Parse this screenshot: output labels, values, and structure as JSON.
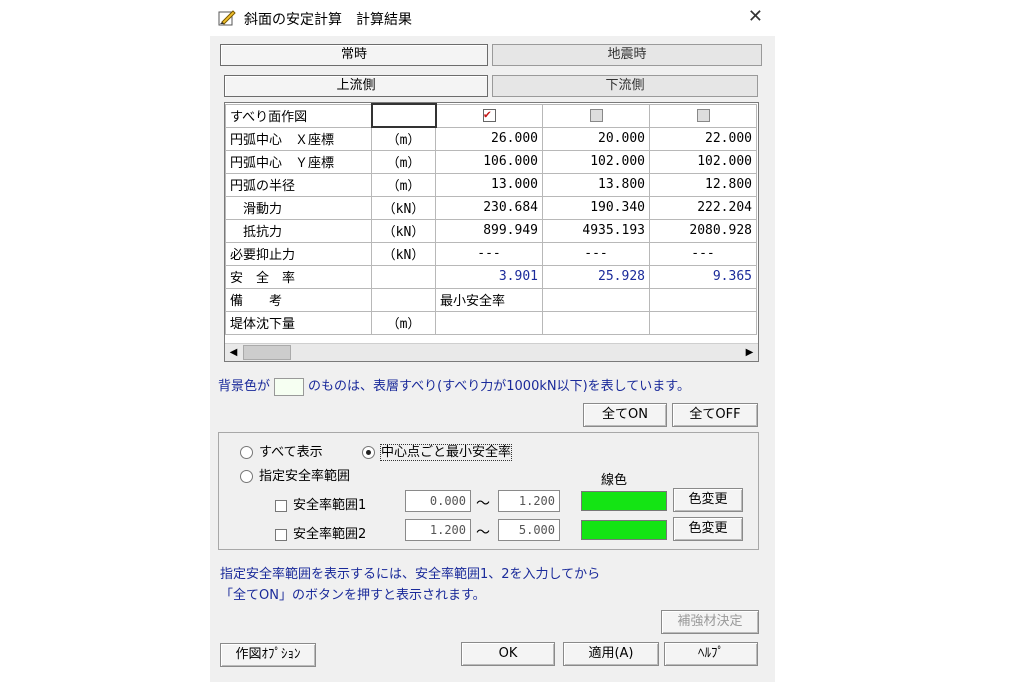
{
  "window": {
    "title": "斜面の安定計算　計算結果",
    "close_glyph": "✕"
  },
  "tabs_top": [
    {
      "label": "常時",
      "selected": true
    },
    {
      "label": "地震時",
      "selected": false
    }
  ],
  "tabs_side": [
    {
      "label": "上流側",
      "selected": true
    },
    {
      "label": "下流側",
      "selected": false
    }
  ],
  "grid": {
    "rows": [
      {
        "label": "すべり面作図",
        "unit": "",
        "type": "check",
        "values": [
          true,
          false,
          false
        ]
      },
      {
        "label": "円弧中心　Ｘ座標",
        "unit": "（m）",
        "values": [
          "26.000",
          "20.000",
          "22.000"
        ]
      },
      {
        "label": "円弧中心　Ｙ座標",
        "unit": "（m）",
        "values": [
          "106.000",
          "102.000",
          "102.000"
        ]
      },
      {
        "label": "円弧の半径",
        "unit": "（m）",
        "values": [
          "13.000",
          "13.800",
          "12.800"
        ]
      },
      {
        "label": "　滑動力",
        "unit": "（kN）",
        "values": [
          "230.684",
          "190.340",
          "222.204"
        ]
      },
      {
        "label": "　抵抗力",
        "unit": "（kN）",
        "values": [
          "899.949",
          "4935.193",
          "2080.928"
        ]
      },
      {
        "label": "必要抑止力",
        "unit": "（kN）",
        "values": [
          "---",
          "---",
          "---"
        ]
      },
      {
        "label": "安　全　率",
        "unit": "",
        "values": [
          "3.901",
          "25.928",
          "9.365"
        ],
        "blue": true
      },
      {
        "label": "備　　考",
        "unit": "",
        "values": [
          "最小安全率",
          "",
          ""
        ]
      },
      {
        "label": "堤体沈下量",
        "unit": "（m）",
        "values": [
          "",
          "",
          ""
        ]
      }
    ]
  },
  "scroll": {
    "left": "◀",
    "right": "▶"
  },
  "note1": {
    "before": "背景色が",
    "after": "のものは、表層すべり(すべり力が1000kN以下)を表しています。"
  },
  "buttons": {
    "all_on": "全てON",
    "all_off": "全てOFF",
    "hokyo": "補強材決定",
    "sakuzu": "作図ｵﾌﾟｼｮﾝ",
    "ok": "OK",
    "apply": "適用(A)",
    "help": "ﾍﾙﾌﾟ"
  },
  "options": {
    "radio_all": "すべて表示",
    "radio_min": "中心点ごと最小安全率",
    "radio_range": "指定安全率範囲",
    "line_color_label": "線色",
    "range1": {
      "label": "安全率範囲1",
      "from": "0.000",
      "to": "1.200",
      "color": "#14e414"
    },
    "range2": {
      "label": "安全率範囲2",
      "from": "1.200",
      "to": "5.000",
      "color": "#14e414"
    },
    "tilde": "～",
    "color_btn": "色変更"
  },
  "note2": {
    "line1": "指定安全率範囲を表示するには、安全率範囲1、2を入力してから",
    "line2": "「全てON」のボタンを押すと表示されます。"
  }
}
